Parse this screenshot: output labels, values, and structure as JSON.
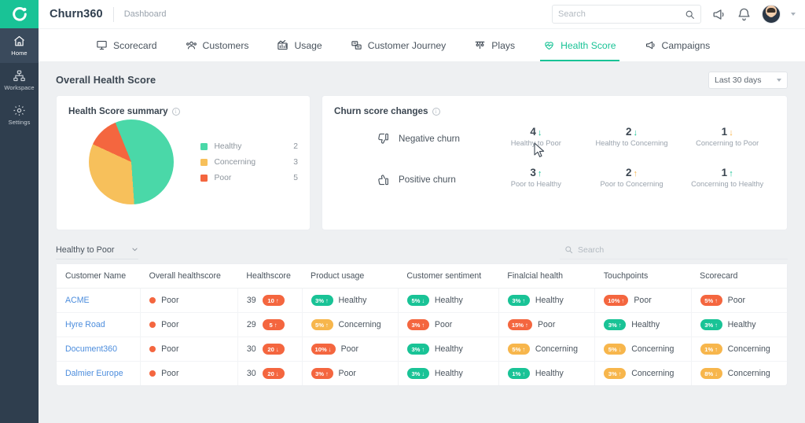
{
  "brand": {
    "name": "Churn360",
    "breadcrumb": "Dashboard"
  },
  "topbar": {
    "search_placeholder": "Search",
    "announce_icon": "megaphone-icon",
    "bell_icon": "bell-icon",
    "avatar_icon": "user-avatar"
  },
  "rail": {
    "logo": "churn360-logo",
    "items": [
      {
        "label": "Home",
        "icon": "home-icon",
        "active": true
      },
      {
        "label": "Workspace",
        "icon": "sitemap-icon",
        "active": false
      },
      {
        "label": "Settings",
        "icon": "gear-icon",
        "active": false
      }
    ]
  },
  "tabs": [
    {
      "label": "Scorecard",
      "icon": "scorecard-icon",
      "active": false
    },
    {
      "label": "Customers",
      "icon": "customers-icon",
      "active": false
    },
    {
      "label": "Usage",
      "icon": "usage-icon",
      "active": false
    },
    {
      "label": "Customer Journey",
      "icon": "journey-icon",
      "active": false
    },
    {
      "label": "Plays",
      "icon": "plays-icon",
      "active": false
    },
    {
      "label": "Health Score",
      "icon": "health-score-icon",
      "active": true
    },
    {
      "label": "Campaigns",
      "icon": "campaigns-icon",
      "active": false
    }
  ],
  "page": {
    "title": "Overall Health Score",
    "range": "Last 30 days"
  },
  "summary_card": {
    "title": "Health Score summary",
    "info_icon": "info-icon"
  },
  "chart_data": {
    "type": "pie",
    "title": "Health Score summary",
    "categories": [
      "Healthy",
      "Concerning",
      "Poor"
    ],
    "values": [
      2,
      3,
      5
    ],
    "slice_percents": [
      55,
      33,
      12
    ],
    "colors": [
      "#4ad8a8",
      "#f7c05b",
      "#f4663f"
    ],
    "legend_position": "right"
  },
  "churn_card": {
    "title": "Churn score changes",
    "info_icon": "info-icon",
    "rows": [
      {
        "label": "Negative churn",
        "icon": "thumbs-down-icon",
        "stats": [
          {
            "value": "4",
            "arrow": "↓",
            "arrow_color": "#19c396",
            "caption": "Healthy to Poor"
          },
          {
            "value": "2",
            "arrow": "↓",
            "arrow_color": "#19c396",
            "caption": "Healthy to Concerning"
          },
          {
            "value": "1",
            "arrow": "↓",
            "arrow_color": "#f7b64c",
            "caption": "Concerning to Poor"
          }
        ]
      },
      {
        "label": "Positive churn",
        "icon": "thumbs-up-icon",
        "stats": [
          {
            "value": "3",
            "arrow": "↑",
            "arrow_color": "#19c396",
            "caption": "Poor to Healthy"
          },
          {
            "value": "2",
            "arrow": "↑",
            "arrow_color": "#f7b64c",
            "caption": "Poor to Concerning"
          },
          {
            "value": "1",
            "arrow": "↑",
            "arrow_color": "#19c396",
            "caption": "Concerning to Healthy"
          }
        ]
      }
    ]
  },
  "filter": {
    "selected": "Healthy to Poor",
    "chevron_icon": "chevron-down-icon"
  },
  "table_search": {
    "placeholder": "Search",
    "icon": "search-icon"
  },
  "table": {
    "columns": [
      "Customer Name",
      "Overall healthscore",
      "Healthscore",
      "Product usage",
      "Customer sentiment",
      "Finalcial health",
      "Touchpoints",
      "Scorecard"
    ],
    "rows": [
      {
        "customer": "ACME",
        "overall": {
          "label": "Poor",
          "color": "#f4663f"
        },
        "healthscore": {
          "score": "39",
          "delta": "10",
          "arrow": "↑",
          "color": "#f4663f"
        },
        "product_usage": {
          "pct": "3%",
          "arrow": "↑",
          "color": "#19c396",
          "label": "Healthy"
        },
        "customer_sentiment": {
          "pct": "5%",
          "arrow": "↓",
          "color": "#19c396",
          "label": "Healthy"
        },
        "financial_health": {
          "pct": "3%",
          "arrow": "↑",
          "color": "#19c396",
          "label": "Healthy"
        },
        "touchpoints": {
          "pct": "10%",
          "arrow": "↑",
          "color": "#f4663f",
          "label": "Poor"
        },
        "scorecard": {
          "pct": "5%",
          "arrow": "↑",
          "color": "#f4663f",
          "label": "Poor"
        }
      },
      {
        "customer": "Hyre Road",
        "overall": {
          "label": "Poor",
          "color": "#f4663f"
        },
        "healthscore": {
          "score": "29",
          "delta": "5",
          "arrow": "↑",
          "color": "#f4663f"
        },
        "product_usage": {
          "pct": "5%",
          "arrow": "↑",
          "color": "#f7b64c",
          "label": "Concerning"
        },
        "customer_sentiment": {
          "pct": "3%",
          "arrow": "↑",
          "color": "#f4663f",
          "label": "Poor"
        },
        "financial_health": {
          "pct": "15%",
          "arrow": "↑",
          "color": "#f4663f",
          "label": "Poor"
        },
        "touchpoints": {
          "pct": "3%",
          "arrow": "↑",
          "color": "#19c396",
          "label": "Healthy"
        },
        "scorecard": {
          "pct": "3%",
          "arrow": "↑",
          "color": "#19c396",
          "label": "Healthy"
        }
      },
      {
        "customer": "Document360",
        "overall": {
          "label": "Poor",
          "color": "#f4663f"
        },
        "healthscore": {
          "score": "30",
          "delta": "20",
          "arrow": "↓",
          "color": "#f4663f"
        },
        "product_usage": {
          "pct": "10%",
          "arrow": "↓",
          "color": "#f4663f",
          "label": "Poor"
        },
        "customer_sentiment": {
          "pct": "3%",
          "arrow": "↑",
          "color": "#19c396",
          "label": "Healthy"
        },
        "financial_health": {
          "pct": "5%",
          "arrow": "↑",
          "color": "#f7b64c",
          "label": "Concerning"
        },
        "touchpoints": {
          "pct": "5%",
          "arrow": "↓",
          "color": "#f7b64c",
          "label": "Concerning"
        },
        "scorecard": {
          "pct": "1%",
          "arrow": "↑",
          "color": "#f7b64c",
          "label": "Concerning"
        }
      },
      {
        "customer": "Dalmier Europe",
        "overall": {
          "label": "Poor",
          "color": "#f4663f"
        },
        "healthscore": {
          "score": "30",
          "delta": "20",
          "arrow": "↓",
          "color": "#f4663f"
        },
        "product_usage": {
          "pct": "3%",
          "arrow": "↑",
          "color": "#f4663f",
          "label": "Poor"
        },
        "customer_sentiment": {
          "pct": "3%",
          "arrow": "↓",
          "color": "#19c396",
          "label": "Healthy"
        },
        "financial_health": {
          "pct": "1%",
          "arrow": "↑",
          "color": "#19c396",
          "label": "Healthy"
        },
        "touchpoints": {
          "pct": "3%",
          "arrow": "↑",
          "color": "#f7b64c",
          "label": "Concerning"
        },
        "scorecard": {
          "pct": "8%",
          "arrow": "↓",
          "color": "#f7b64c",
          "label": "Concerning"
        }
      }
    ]
  }
}
